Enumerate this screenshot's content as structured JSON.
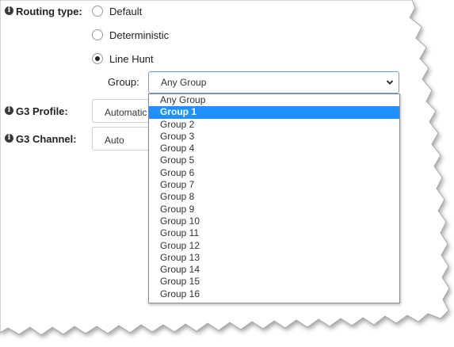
{
  "routing": {
    "label": "Routing type:",
    "options": [
      {
        "label": "Default",
        "checked": false
      },
      {
        "label": "Deterministic",
        "checked": false
      },
      {
        "label": "Line Hunt",
        "checked": true
      }
    ]
  },
  "group": {
    "label": "Group:",
    "selected_value": "Any Group",
    "highlighted_index": 1,
    "options": [
      "Any Group",
      "Group 1",
      "Group 2",
      "Group 3",
      "Group 4",
      "Group 5",
      "Group 6",
      "Group 7",
      "Group 8",
      "Group 9",
      "Group 10",
      "Group 11",
      "Group 12",
      "Group 13",
      "Group 14",
      "Group 15",
      "Group 16"
    ]
  },
  "g3_profile": {
    "label": "G3 Profile:",
    "value": "Automatic"
  },
  "g3_channel": {
    "label": "G3 Channel:",
    "value": "Auto"
  },
  "icons": {
    "info": "info-icon",
    "chevron": "chevron-down-icon"
  },
  "colors": {
    "highlight": "#1e90ff",
    "focus_border": "#6f9fd8"
  }
}
